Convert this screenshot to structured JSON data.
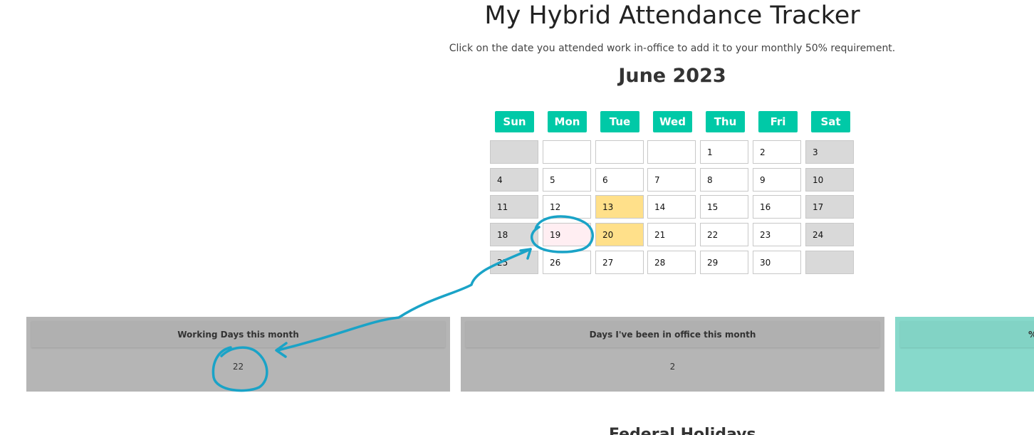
{
  "header": {
    "title": "My Hybrid Attendance Tracker",
    "instructions": "Click on the date you attended work in-office to add it to your monthly 50% requirement."
  },
  "calendar": {
    "month_label": "June 2023",
    "weekdays": [
      "Sun",
      "Mon",
      "Tue",
      "Wed",
      "Thu",
      "Fri",
      "Sat"
    ],
    "weeks": [
      [
        "",
        "",
        "",
        "",
        "1",
        "2",
        "3"
      ],
      [
        "4",
        "5",
        "6",
        "7",
        "8",
        "9",
        "10"
      ],
      [
        "11",
        "12",
        "13",
        "14",
        "15",
        "16",
        "17"
      ],
      [
        "18",
        "19",
        "20",
        "21",
        "22",
        "23",
        "24"
      ],
      [
        "25",
        "26",
        "27",
        "28",
        "29",
        "30",
        ""
      ]
    ],
    "attended_dates": [
      "13",
      "20"
    ],
    "highlighted_date": "19",
    "colors": {
      "weekday_header": "#00c9a7",
      "weekend_cell": "#d9d9d9",
      "attended_cell": "#ffe08a",
      "highlighted_cell": "#ffeef2"
    }
  },
  "stats": {
    "working_days": {
      "label": "Working Days this month",
      "value": "22"
    },
    "office_days": {
      "label": "Days I've been in office this month",
      "value": "2"
    },
    "percent": {
      "label": "%",
      "value": ""
    }
  },
  "next_section": {
    "heading": "Federal Holidays"
  },
  "annotation": {
    "color": "#1aa3c7"
  }
}
